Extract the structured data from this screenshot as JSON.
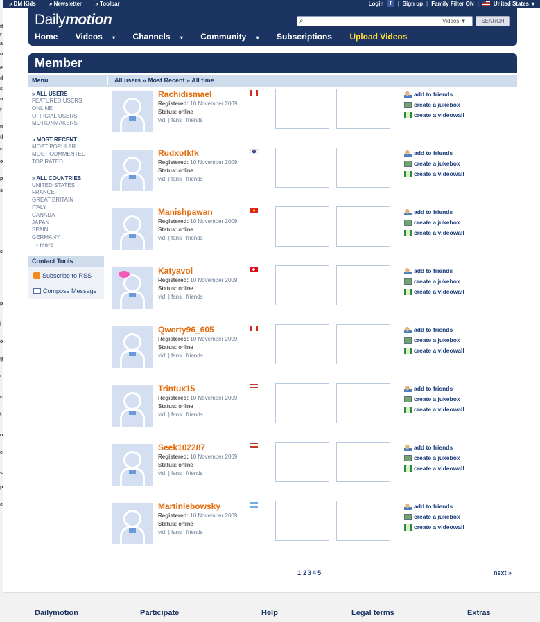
{
  "topbar": {
    "left_links": [
      "» DM Kids",
      "» Newsletter",
      "» Toolbar"
    ],
    "login": "Login",
    "facebook_icon": "facebook-icon",
    "signup": "Sign up",
    "family_filter": "Family Filter ON",
    "country": "United States",
    "country_caret": "▾"
  },
  "header": {
    "logo_light": "Daily",
    "logo_bold": "motion",
    "search_placeholder": "",
    "search_category": "Videos ▼",
    "search_button": "SEARCH",
    "nav": [
      {
        "label": "Home",
        "caret": ""
      },
      {
        "label": "Videos",
        "caret": "▾"
      },
      {
        "label": "Channels",
        "caret": "▾"
      },
      {
        "label": "Community",
        "caret": "▾"
      },
      {
        "label": "Subscriptions",
        "caret": ""
      },
      {
        "label": "Upload Videos",
        "caret": ""
      }
    ]
  },
  "page": {
    "title": "Member",
    "menu_label": "Menu",
    "breadcrumb": "All users » Most Recent » All time"
  },
  "sidebar": {
    "groups": [
      {
        "heading": "» ALL USERS",
        "items": [
          "FEATURED USERS",
          "ONLINE",
          "OFFICIAL USERS",
          "MOTIONMAKERS"
        ]
      },
      {
        "heading": "» MOST RECENT",
        "items": [
          "MOST POPULAR",
          "MOST COMMENTED",
          "TOP RATED"
        ]
      },
      {
        "heading": "» ALL COUNTRIES",
        "items": [
          "UNITED STATES",
          "FRANCE",
          "GREAT BRITAIN",
          "ITALY",
          "CANADA",
          "JAPAN",
          "SPAIN",
          "GERMANY"
        ]
      }
    ],
    "more": "more",
    "contact_tools": {
      "heading": "Contact Tools",
      "rss": "Subscribe to RSS",
      "compose": "Compose Message"
    }
  },
  "labels": {
    "registered": "Registered:",
    "status": "Status:",
    "vid": "vid.",
    "fans": "fans",
    "friends": "friends",
    "sep": "|",
    "add_friends": "add to friends",
    "jukebox": "create a jukebox",
    "videowall": "create a videowall"
  },
  "members": [
    {
      "name": "Rachidismael",
      "flag": "canada",
      "date": "10 November 2009",
      "status": "online"
    },
    {
      "name": "Rudxotkfk",
      "flag": "korea",
      "date": "10 November 2009",
      "status": "online"
    },
    {
      "name": "Manishpawan",
      "flag": "vietnam",
      "date": "10 November 2009",
      "status": "online"
    },
    {
      "name": "Katyavol",
      "flag": "turkey",
      "date": "10 November 2009",
      "status": "online"
    },
    {
      "name": "Qwerty96_605",
      "flag": "canada",
      "date": "10 November 2009",
      "status": "online"
    },
    {
      "name": "Trintux15",
      "flag": "usa",
      "date": "10 November 2009",
      "status": "online"
    },
    {
      "name": "Seek102287",
      "flag": "usa",
      "date": "10 November 2009",
      "status": "online"
    },
    {
      "name": "Martinlebowsky",
      "flag": "argentina",
      "date": "10 November 2009",
      "status": "online"
    }
  ],
  "pagination": {
    "current": "1",
    "pages": [
      "2",
      "3",
      "4",
      "5"
    ],
    "next": "next »"
  },
  "footer": [
    "Dailymotion",
    "Participate",
    "Help",
    "Legal terms",
    "Extras"
  ],
  "colors": {
    "navy": "#1b3461",
    "orange": "#e56b0a",
    "yellow": "#ffd93d",
    "light_blue": "#cfdcec"
  }
}
